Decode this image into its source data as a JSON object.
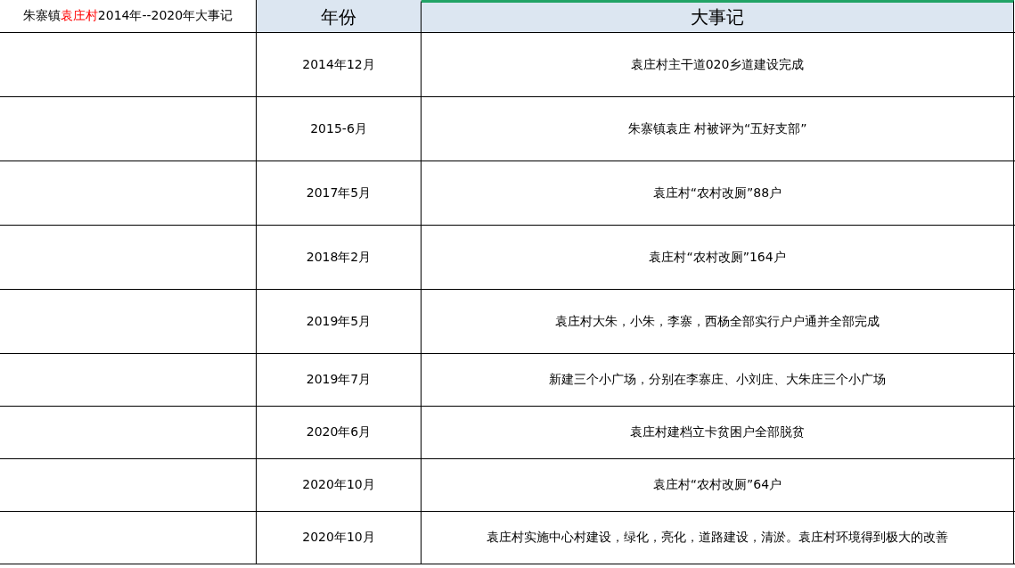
{
  "title": {
    "parts": [
      {
        "text": "朱寨镇",
        "highlighted": false
      },
      {
        "text": "袁庄村",
        "highlighted": true
      },
      {
        "text": "2014年--2020年大事记",
        "highlighted": false
      }
    ]
  },
  "columns": [
    {
      "label": "年份",
      "selected": false
    },
    {
      "label": "大事记",
      "selected": true
    }
  ],
  "rows": [
    {
      "date": "2014年12月",
      "event": "袁庄村主干道020乡道建设完成"
    },
    {
      "date": "2015-6月",
      "event": "朱寨镇袁庄 村被评为“五好支部”"
    },
    {
      "date": "2017年5月",
      "event": "袁庄村“农村改厕”88户"
    },
    {
      "date": "2018年2月",
      "event": "袁庄村“农村改厕”164户"
    },
    {
      "date": "2019年5月",
      "event": "袁庄村大朱，小朱，李寨，西杨全部实行户户通并全部完成"
    },
    {
      "date": "2019年7月",
      "event": "新建三个小广场，分别在李寨庄、小刘庄、大朱庄三个小广场"
    },
    {
      "date": "2020年6月",
      "event": "袁庄村建档立卡贫困户全部脱贫"
    },
    {
      "date": "2020年10月",
      "event": "袁庄村“农村改厕”64户"
    },
    {
      "date": "2020年10月",
      "event": "袁庄村实施中心村建设，绿化，亮化，道路建设，清淤。袁庄村环境得到极大的改善"
    }
  ]
}
